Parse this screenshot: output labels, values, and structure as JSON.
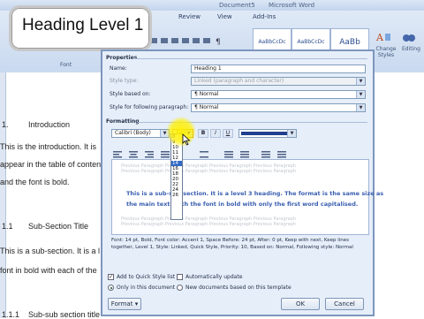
{
  "window": {
    "title_left": "Document5",
    "title_right": "Microsoft Word"
  },
  "ribbon": {
    "tabs": [
      "Review",
      "View",
      "Add-Ins"
    ],
    "styles": [
      "AaBbCcDc",
      "AaBbCcDc",
      "AaBb"
    ],
    "change_styles_label": "Change Styles",
    "editing_label": "Editing",
    "font_group_label": "Font"
  },
  "tooltip": {
    "text": "Heading Level 1"
  },
  "document": {
    "lines": [
      {
        "num": "1.",
        "text": "Introduction"
      },
      {
        "text": "This is the introduction. It is"
      },
      {
        "text": "appear in the table of content"
      },
      {
        "text": "and the font is bold."
      },
      {
        "num": "1.1",
        "text": "Sub-Section Title"
      },
      {
        "text": "This is a sub-section. It is a l"
      },
      {
        "text": "font in bold with each of the"
      },
      {
        "num": "1.1.1",
        "text": "Sub-sub section title"
      }
    ]
  },
  "dialog": {
    "properties_label": "Properties",
    "name_label": "Name:",
    "name_value": "Heading 1",
    "style_type_label": "Style type:",
    "style_type_value": "Linked (paragraph and character)",
    "style_based_label": "Style based on:",
    "style_based_value": "¶ Normal",
    "style_following_label": "Style for following paragraph:",
    "style_following_value": "¶ Normal",
    "formatting_label": "Formatting",
    "font_value": "Calibri (Body)",
    "size_value": "14",
    "bold": "B",
    "italic": "I",
    "underline": "U",
    "font_sizes": [
      "8",
      "9",
      "10",
      "11",
      "12",
      "14",
      "16",
      "18",
      "20",
      "22",
      "24",
      "26"
    ],
    "selected_size": "14",
    "preview_line1": "This is a sub-sub-section. It is a level 3 heading. The format is the same size as",
    "preview_line2": "the main text, with the font in bold with only the first word capitalised.",
    "ghost_text": "Previous Paragraph Previous Paragraph Previous Paragraph Previous Paragraph",
    "description": "Font: 14 pt, Bold, Font color: Accent 1, Space Before: 24 pt, After: 0 pt, Keep with next, Keep lines together, Level 1, Style: Linked, Quick Style, Priority: 10, Based on: Normal, Following style: Normal",
    "add_quick_label": "Add to Quick Style list",
    "auto_update_label": "Automatically update",
    "only_doc_label": "Only in this document",
    "new_docs_label": "New documents based on this template",
    "format_btn": "Format ▾",
    "ok_btn": "OK",
    "cancel_btn": "Cancel",
    "font_color": "#1f3f8f"
  }
}
